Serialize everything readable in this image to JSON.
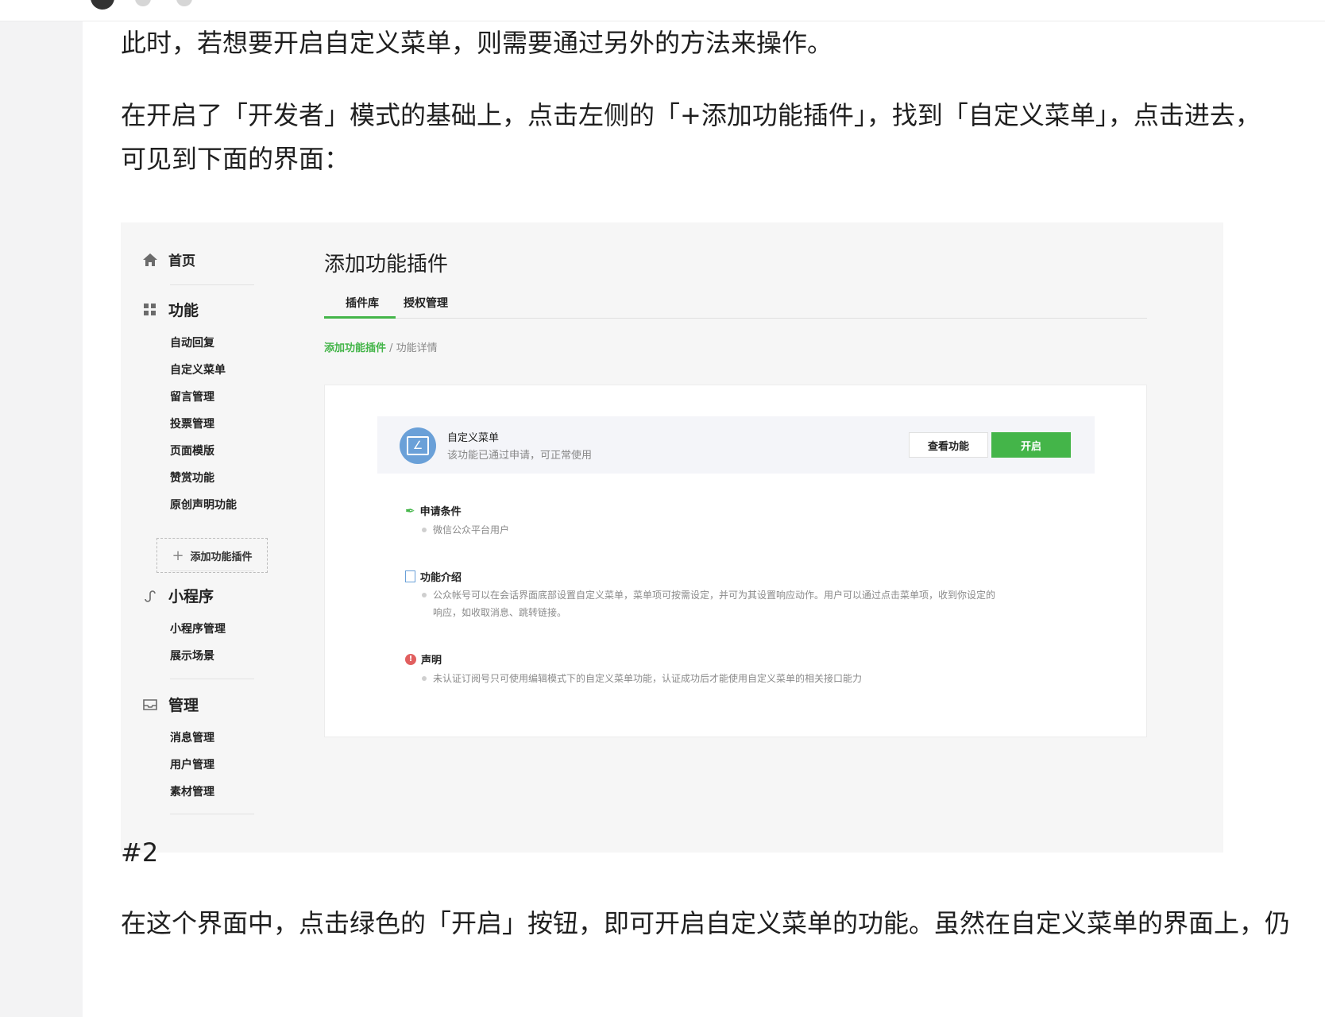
{
  "article": {
    "para1": "此时，若想要开启自定义菜单，则需要通过另外的方法来操作。",
    "para2_line1": "在开启了「开发者」模式的基础上，点击左侧的「+添加功能插件」，找到「自定义菜单」，点击进去，",
    "para2_line2": "可见到下面的界面：",
    "caption": "#2",
    "para3": "在这个界面中，点击绿色的「开启」按钮，即可开启自定义菜单的功能。虽然在自定义菜单的界面上，仍"
  },
  "screenshot": {
    "sidebar": {
      "home": "首页",
      "features": "功能",
      "feature_items": [
        "自动回复",
        "自定义菜单",
        "留言管理",
        "投票管理",
        "页面模版",
        "赞赏功能",
        "原创声明功能"
      ],
      "add_plugin": "添加功能插件",
      "miniprogram": "小程序",
      "miniprogram_items": [
        "小程序管理",
        "展示场景"
      ],
      "manage": "管理",
      "manage_items": [
        "消息管理",
        "用户管理",
        "素材管理"
      ]
    },
    "page_title": "添加功能插件",
    "tabs": [
      "插件库",
      "授权管理"
    ],
    "breadcrumb": {
      "parent": "添加功能插件",
      "sep": " / ",
      "current": "功能详情"
    },
    "feature": {
      "name": "自定义菜单",
      "desc": "该功能已通过申请，可正常使用",
      "view_button": "查看功能",
      "open_button": "开启"
    },
    "sections": {
      "conditions_title": "申请条件",
      "conditions_item": "微信公众平台用户",
      "intro_title": "功能介绍",
      "intro_line1": "公众帐号可以在会话界面底部设置自定义菜单，菜单项可按需设定，并可为其设置响应动作。用户可以通过点击菜单项，收到你设定的",
      "intro_line2": "响应，如收取消息、跳转链接。",
      "statement_title": "声明",
      "statement_item": "未认证订阅号只可使用编辑模式下的自定义菜单功能，认证成功后才能使用自定义菜单的相关接口能力"
    },
    "colors": {
      "accent": "#44b549",
      "feature_icon": "#6aa0d8"
    }
  }
}
